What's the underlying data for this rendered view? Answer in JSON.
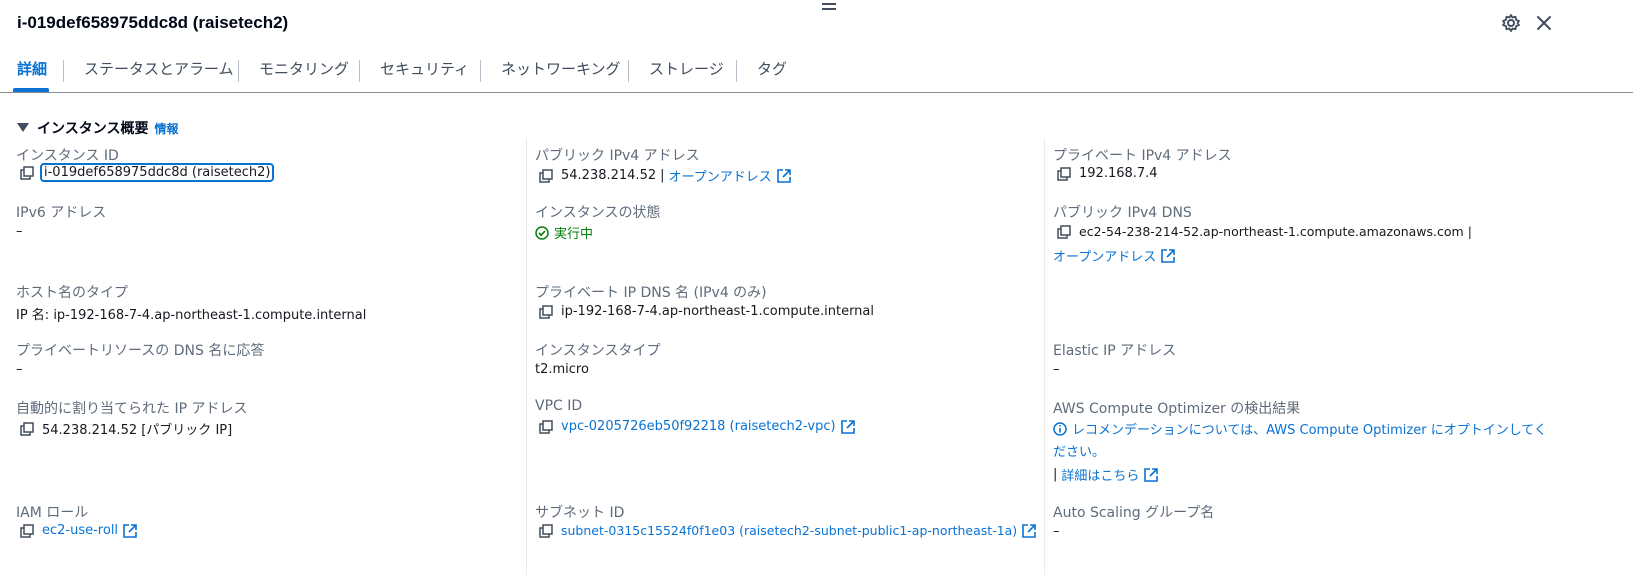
{
  "header": {
    "title": "i-019def658975ddc8d (raisetech2)"
  },
  "tabs": [
    {
      "label": "詳細"
    },
    {
      "label": "ステータスとアラーム"
    },
    {
      "label": "モニタリング"
    },
    {
      "label": "セキュリティ"
    },
    {
      "label": "ネットワーキング"
    },
    {
      "label": "ストレージ"
    },
    {
      "label": "タグ"
    }
  ],
  "section": {
    "title": "インスタンス概要",
    "info_label": "情報"
  },
  "fields": {
    "instance_id": {
      "label": "インスタンス ID",
      "value": "i-019def658975ddc8d (raisetech2)"
    },
    "public_ipv4": {
      "label": "パブリック IPv4 アドレス",
      "value": "54.238.214.52",
      "sep": "|",
      "link": "オープンアドレス"
    },
    "private_ipv4": {
      "label": "プライベート IPv4 アドレス",
      "value": "192.168.7.4"
    },
    "ipv6": {
      "label": "IPv6 アドレス",
      "value": "–"
    },
    "instance_state": {
      "label": "インスタンスの状態",
      "value": "実行中"
    },
    "public_dns": {
      "label": "パブリック IPv4 DNS",
      "value": "ec2-54-238-214-52.ap-northeast-1.compute.amazonaws.com",
      "sep": "|",
      "link": "オープンアドレス"
    },
    "hostname_type": {
      "label": "ホスト名のタイプ",
      "value": "IP 名: ip-192-168-7-4.ap-northeast-1.compute.internal"
    },
    "private_dns": {
      "label": "プライベート IP DNS 名 (IPv4 のみ)",
      "value": "ip-192-168-7-4.ap-northeast-1.compute.internal"
    },
    "private_resource_dns": {
      "label": "プライベートリソースの DNS 名に応答",
      "value": "–"
    },
    "instance_type": {
      "label": "インスタンスタイプ",
      "value": "t2.micro"
    },
    "elastic_ip": {
      "label": "Elastic IP アドレス",
      "value": "–"
    },
    "auto_ip": {
      "label": "自動的に割り当てられた IP アドレス",
      "value": "54.238.214.52 [パブリック IP]"
    },
    "vpc_id": {
      "label": "VPC ID",
      "value": "vpc-0205726eb50f92218 (raisetech2-vpc)"
    },
    "optimizer": {
      "label": "AWS Compute Optimizer の検出結果",
      "line1": "レコメンデーションについては、AWS Compute Optimizer にオプトインしてく",
      "line2": "ださい。",
      "sep": "|",
      "link": "詳細はこちら"
    },
    "iam_role": {
      "label": "IAM ロール",
      "value": "ec2-use-roll"
    },
    "subnet_id": {
      "label": "サブネット ID",
      "value": "subnet-0315c15524f0f1e03 (raisetech2-subnet-public1-ap-northeast-1a)"
    },
    "asg": {
      "label": "Auto Scaling グループ名",
      "value": "–"
    }
  },
  "icons": {
    "settings": "gear-icon",
    "close": "close-icon",
    "copy": "copy-icon",
    "external": "external-link-icon",
    "status": "check-circle-icon",
    "info": "info-circle-icon"
  },
  "colors": {
    "accent": "#0972d3",
    "success": "#037f0c",
    "label": "#5f6b7a"
  }
}
